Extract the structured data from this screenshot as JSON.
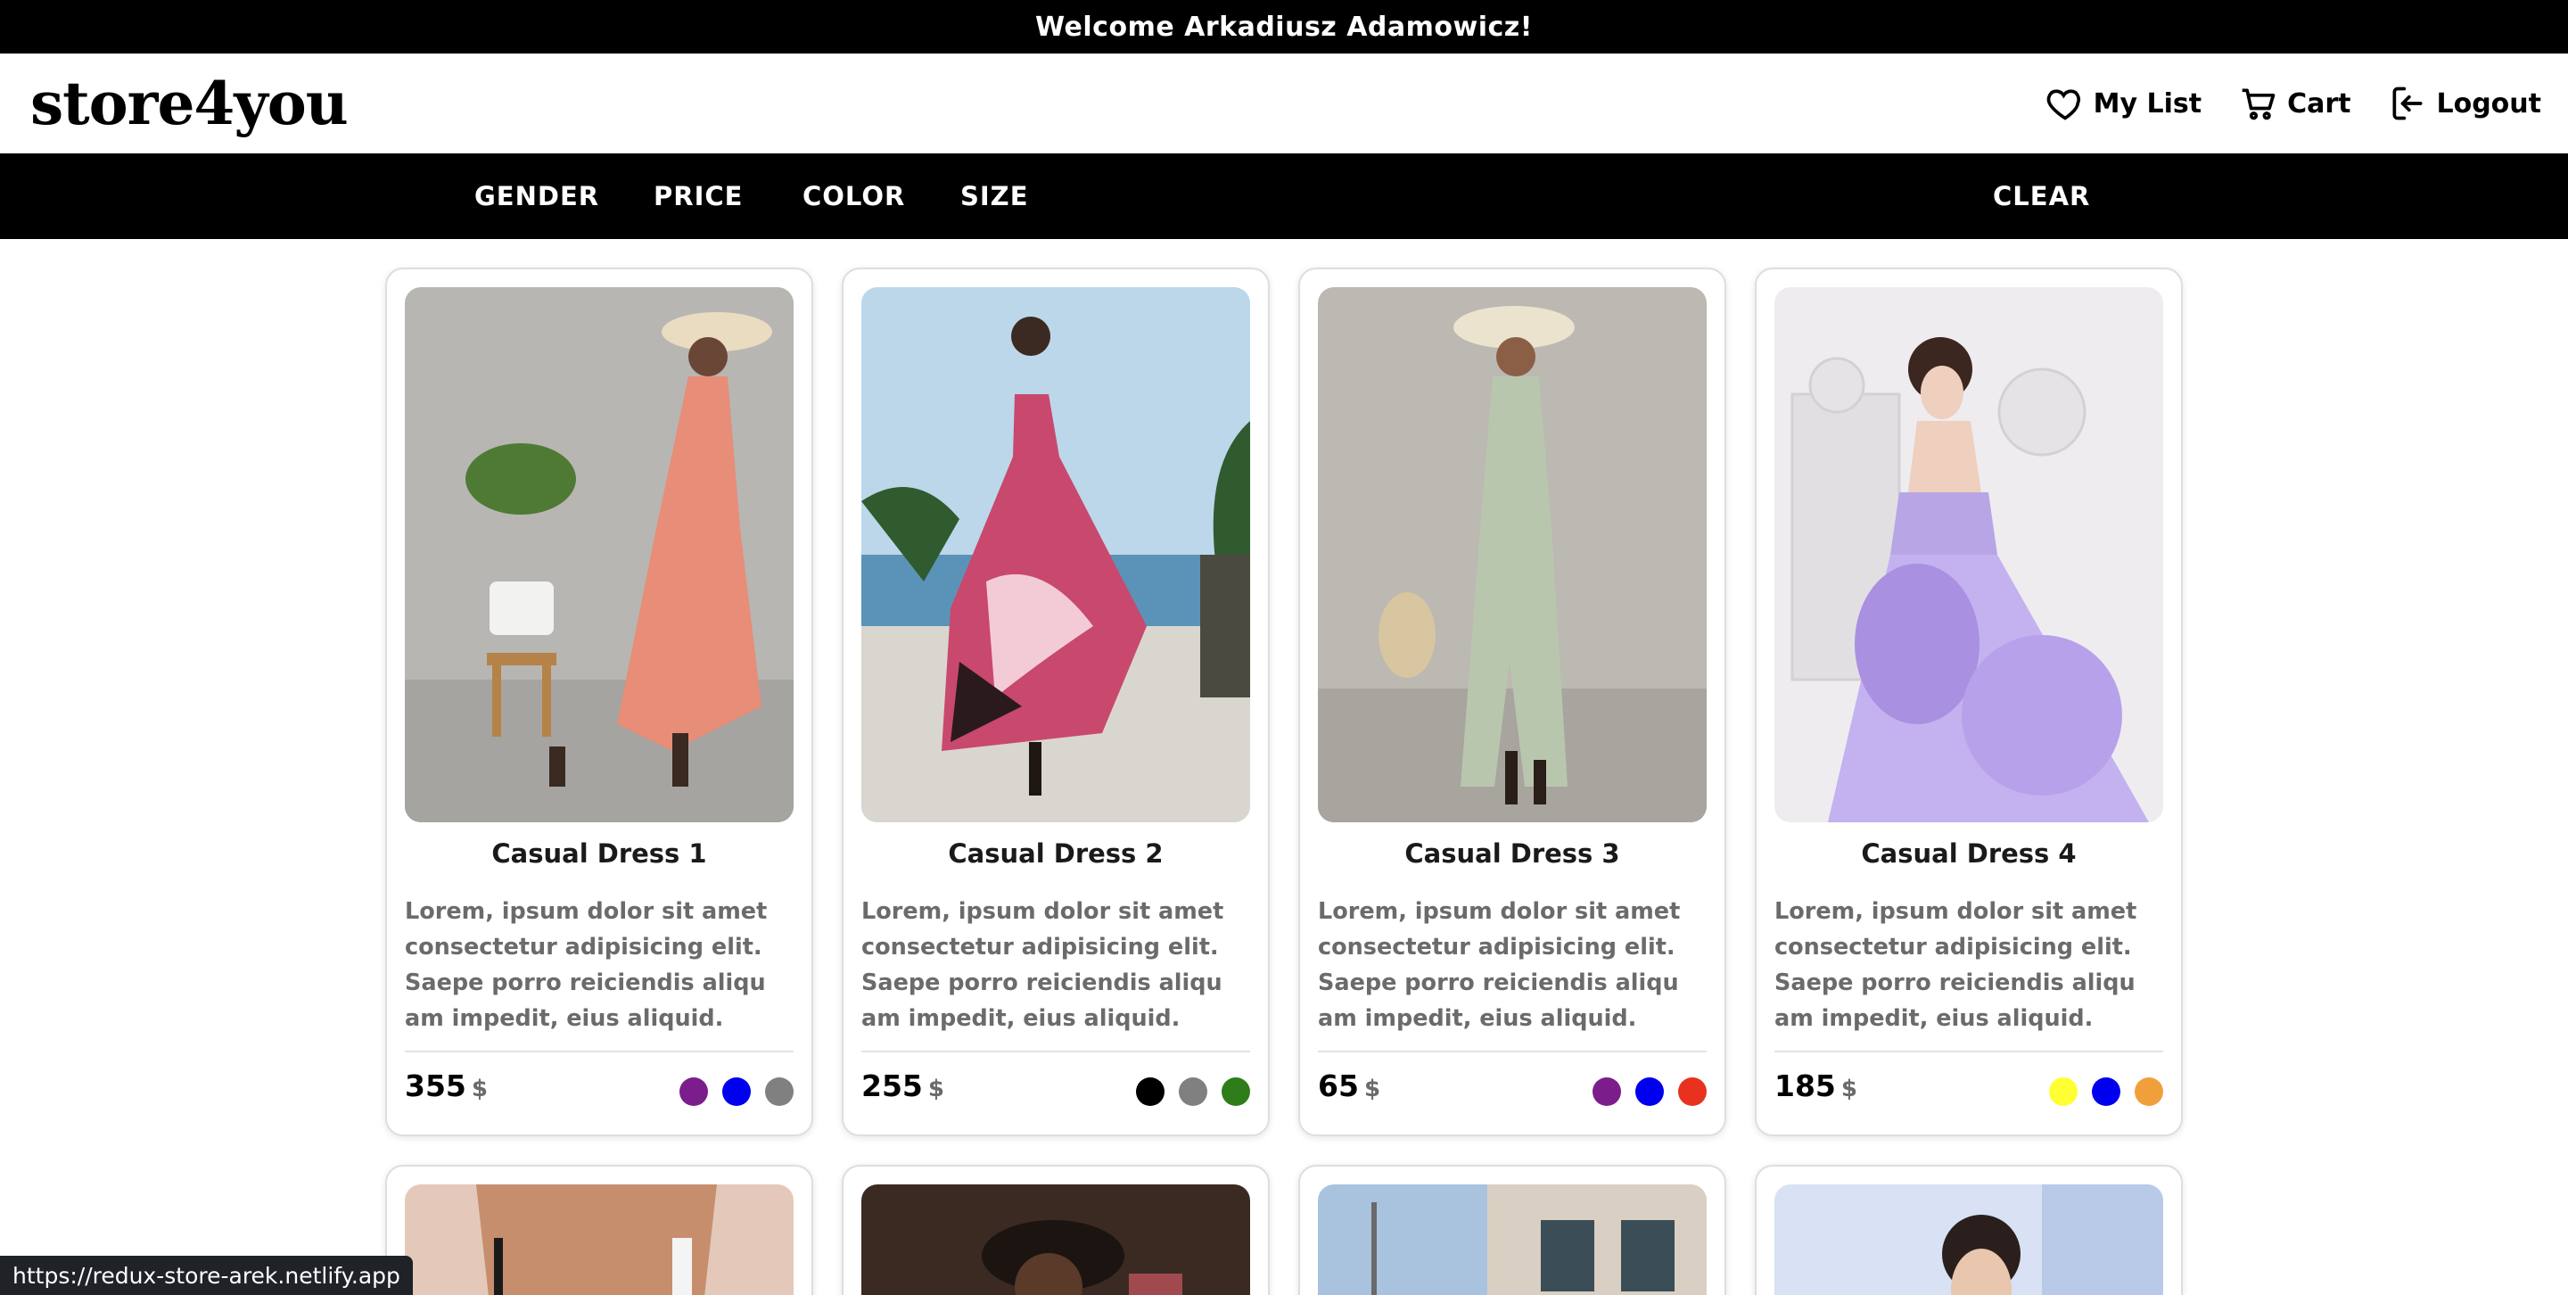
{
  "welcome": "Welcome Arkadiusz Adamowicz!",
  "header": {
    "logo": "store4you",
    "my_list": "My List",
    "cart": "Cart",
    "logout": "Logout"
  },
  "filters": {
    "gender": "GENDER",
    "price": "PRICE",
    "color": "COLOR",
    "size": "SIZE",
    "clear": "CLEAR"
  },
  "products": [
    {
      "title": "Casual Dress 1",
      "description": "Lorem, ipsum dolor sit amet consectetur adipisicing elit. Saepe porro reiciendis aliqu am impedit, eius aliquid.",
      "price": "355",
      "currency": "$",
      "colors": [
        "#7b1e8c",
        "#0000ee",
        "#808080"
      ]
    },
    {
      "title": "Casual Dress 2",
      "description": "Lorem, ipsum dolor sit amet consectetur adipisicing elit. Saepe porro reiciendis aliqu am impedit, eius aliquid.",
      "price": "255",
      "currency": "$",
      "colors": [
        "#000000",
        "#808080",
        "#2e7d1a"
      ]
    },
    {
      "title": "Casual Dress 3",
      "description": "Lorem, ipsum dolor sit amet consectetur adipisicing elit. Saepe porro reiciendis aliqu am impedit, eius aliquid.",
      "price": "65",
      "currency": "$",
      "colors": [
        "#7b1e8c",
        "#0000ee",
        "#e8321e"
      ]
    },
    {
      "title": "Casual Dress 4",
      "description": "Lorem, ipsum dolor sit amet consectetur adipisicing elit. Saepe porro reiciendis aliqu am impedit, eius aliquid.",
      "price": "185",
      "currency": "$",
      "colors": [
        "#ffff33",
        "#0000ee",
        "#f0a03a"
      ]
    }
  ],
  "status_url": "https://redux-store-arek.netlify.app"
}
